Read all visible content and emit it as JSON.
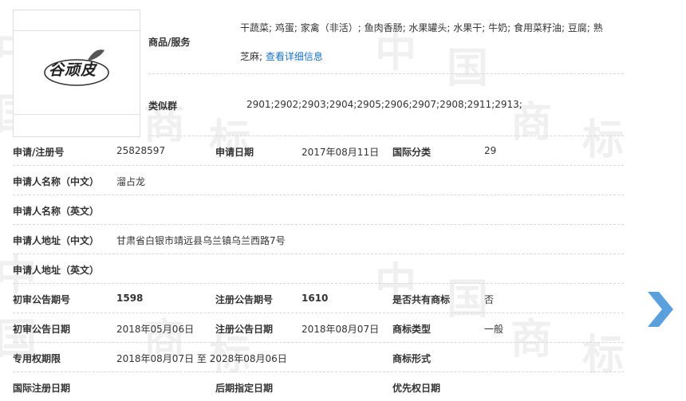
{
  "watermark": {
    "char_a": "中",
    "char_b": "国",
    "char_c": "商",
    "char_d": "标"
  },
  "logo": {
    "text": "谷顽皮"
  },
  "goods": {
    "label": "商品/服务",
    "line1": "干蔬菜; 鸡蛋; 家禽（非活）; 鱼肉香肠; 水果罐头; 水果干; 牛奶; 食用菜籽油; 豆腐; 熟",
    "line2": "芝麻;",
    "detail_link": "查看详细信息"
  },
  "similar_group": {
    "label": "类似群",
    "value": "2901;2902;2903;2904;2905;2906;2907;2908;2911;2913;"
  },
  "rows": {
    "reg_no_label": "申请/注册号",
    "reg_no": "25828597",
    "apply_date_label": "申请日期",
    "apply_date": "2017年08月11日",
    "intl_class_label": "国际分类",
    "intl_class": "29",
    "applicant_cn_label": "申请人名称（中文）",
    "applicant_cn": "溜占龙",
    "applicant_en_label": "申请人名称（英文）",
    "address_cn_label": "申请人地址（中文）",
    "address_cn": "甘肃省白银市靖远县乌兰镇乌兰西路7号",
    "address_en_label": "申请人地址（英文）",
    "prelim_no_label": "初审公告期号",
    "prelim_no": "1598",
    "reg_pub_no_label": "注册公告期号",
    "reg_pub_no": "1610",
    "shared_label": "是否共有商标",
    "shared": "否",
    "prelim_date_label": "初审公告日期",
    "prelim_date": "2018年05月06日",
    "reg_pub_date_label": "注册公告日期",
    "reg_pub_date": "2018年08月07日",
    "type_label": "商标类型",
    "type": "一般",
    "exclusive_label": "专用权期限",
    "exclusive": "2018年08月07日 至 2028年08月06日",
    "form_label": "商标形式",
    "intl_reg_date_label": "国际注册日期",
    "later_date_label": "后期指定日期",
    "priority_label": "优先权日期"
  },
  "colors": {
    "link": "#1a73c8",
    "arrow": "#5aa0dc",
    "divider": "#d8d8d8",
    "watermark": "#f0f0f0"
  },
  "icons": {
    "next": "chevron-right-icon"
  }
}
